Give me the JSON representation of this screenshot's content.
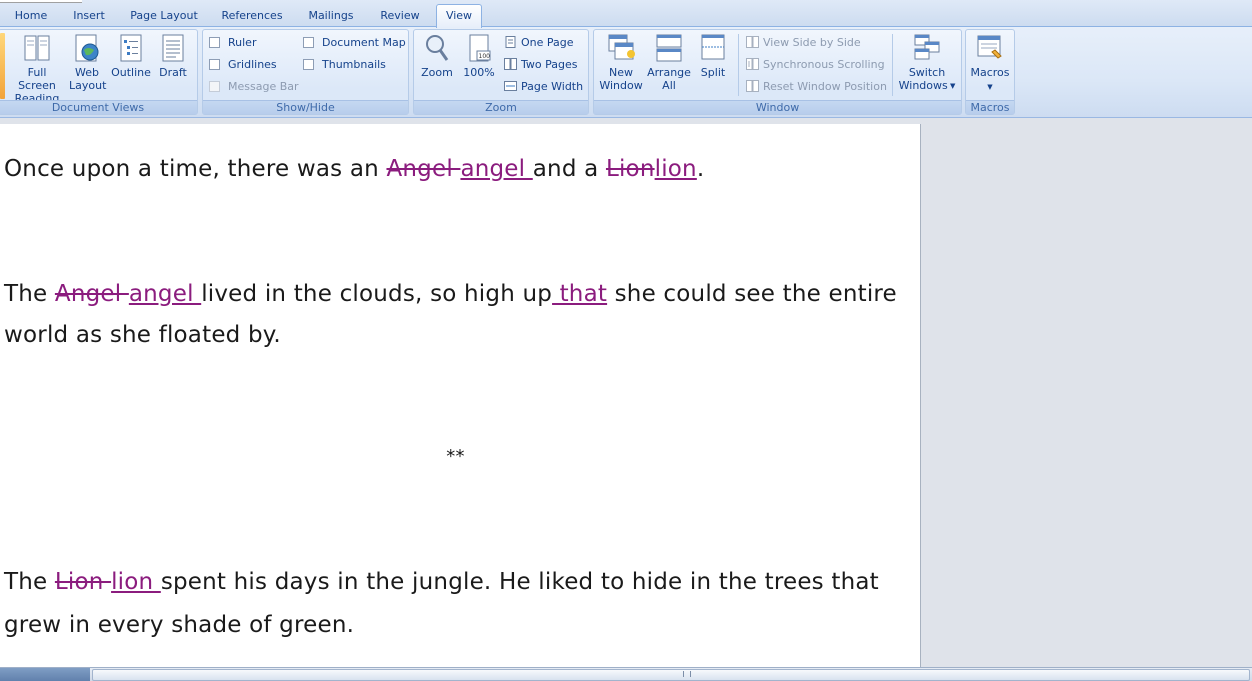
{
  "tabs": [
    "Home",
    "Insert",
    "Page Layout",
    "References",
    "Mailings",
    "Review",
    "View"
  ],
  "active_tab": "View",
  "groups": {
    "document_views": {
      "label": "Document Views",
      "buttons": [
        {
          "line1": "Full Screen",
          "line2": "Reading",
          "icon": "full-screen-reading-icon"
        },
        {
          "line1": "Web",
          "line2": "Layout",
          "icon": "web-layout-icon"
        },
        {
          "line1": "Outline",
          "line2": "",
          "icon": "outline-icon"
        },
        {
          "line1": "Draft",
          "line2": "",
          "icon": "draft-icon"
        }
      ]
    },
    "show_hide": {
      "label": "Show/Hide",
      "ruler": "Ruler",
      "gridlines": "Gridlines",
      "message_bar": "Message Bar",
      "document_map": "Document Map",
      "thumbnails": "Thumbnails"
    },
    "zoom": {
      "label": "Zoom",
      "zoom": "Zoom",
      "hundred": "100%",
      "one_page": "One Page",
      "two_pages": "Two Pages",
      "page_width": "Page Width"
    },
    "window": {
      "label": "Window",
      "new_window_1": "New",
      "new_window_2": "Window",
      "arrange_all_1": "Arrange",
      "arrange_all_2": "All",
      "split": "Split",
      "view_side_by_side": "View Side by Side",
      "sync_scrolling": "Synchronous Scrolling",
      "reset_window_position": "Reset Window Position",
      "switch_windows_1": "Switch",
      "switch_windows_2": "Windows"
    },
    "macros": {
      "label": "Macros",
      "macros": "Macros"
    }
  },
  "document": {
    "p1": {
      "a": "Once upon a time, there was an ",
      "d1": "Angel ",
      "i1": "angel ",
      "b": "and a ",
      "d2": "Lion",
      "i2": "lion",
      "c": "."
    },
    "p2": {
      "a": "The ",
      "d1": "Angel ",
      "i1": "angel ",
      "b": "lived in the clouds, so high up",
      "i2": " that",
      "c": " she could see the entire world as she floated by."
    },
    "separator": "**",
    "p3": {
      "a": "The ",
      "d1": "Lion ",
      "i1": "lion ",
      "b": "spent his days in the jungle. He liked to hide in the trees that grew in every shade of green."
    }
  },
  "colors": {
    "revision": "#8b1c7e",
    "ribbon_text": "#15428b"
  }
}
